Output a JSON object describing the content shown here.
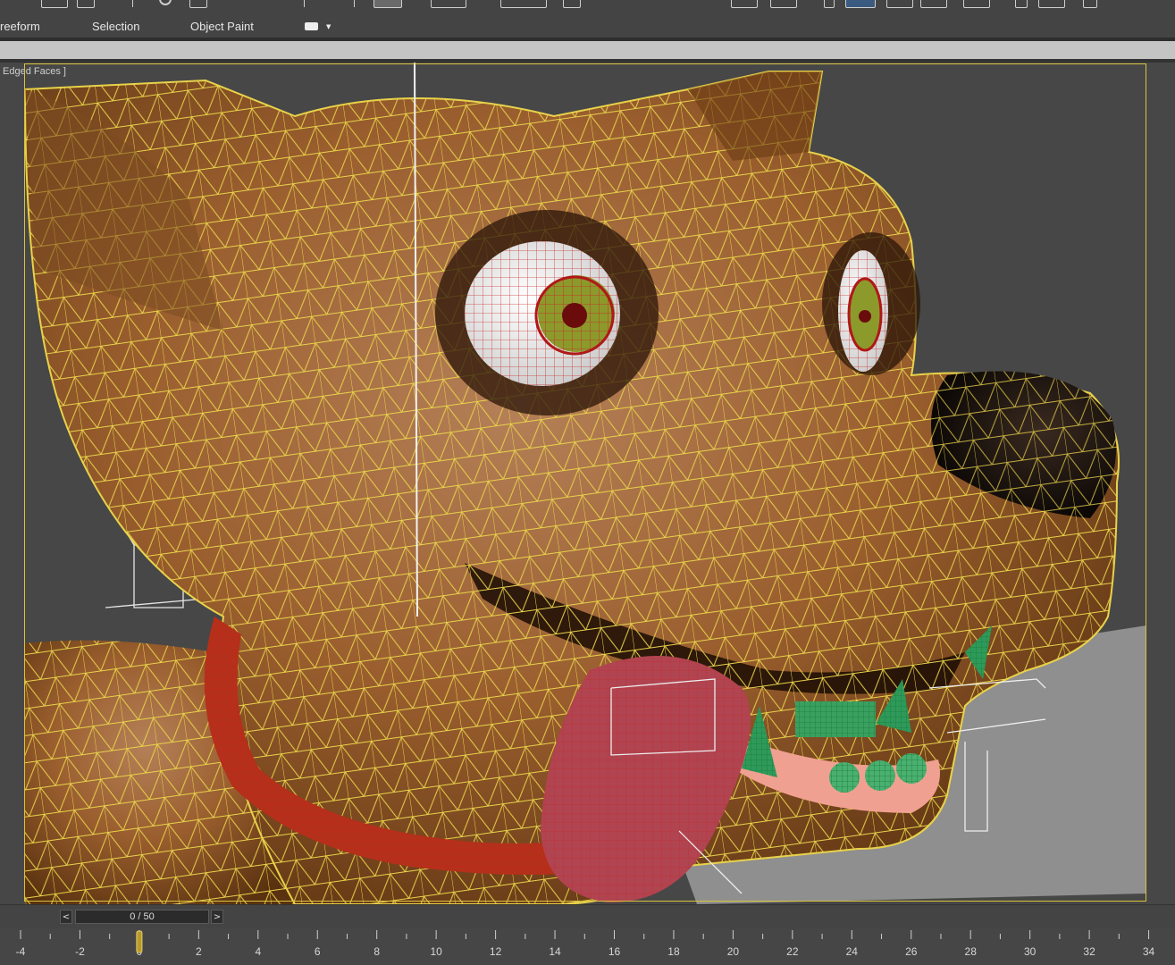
{
  "ribbon": {
    "tabs": [
      {
        "label": "reeform"
      },
      {
        "label": "Selection"
      },
      {
        "label": "Object Paint"
      }
    ]
  },
  "viewport": {
    "label": "Edged Faces ]",
    "colors": {
      "background": "#474747",
      "wireframe": "#e8d24a",
      "frame": "#d8c23e"
    }
  },
  "timeline": {
    "prev_label": "<",
    "next_label": ">",
    "frame_display": "0 / 50",
    "current_frame": 0,
    "ruler": {
      "ticks": [
        "-4",
        "-2",
        "0",
        "2",
        "4",
        "6",
        "8",
        "10",
        "12",
        "14",
        "16",
        "18",
        "20",
        "22",
        "24",
        "26",
        "28",
        "30",
        "32",
        "34"
      ]
    }
  }
}
